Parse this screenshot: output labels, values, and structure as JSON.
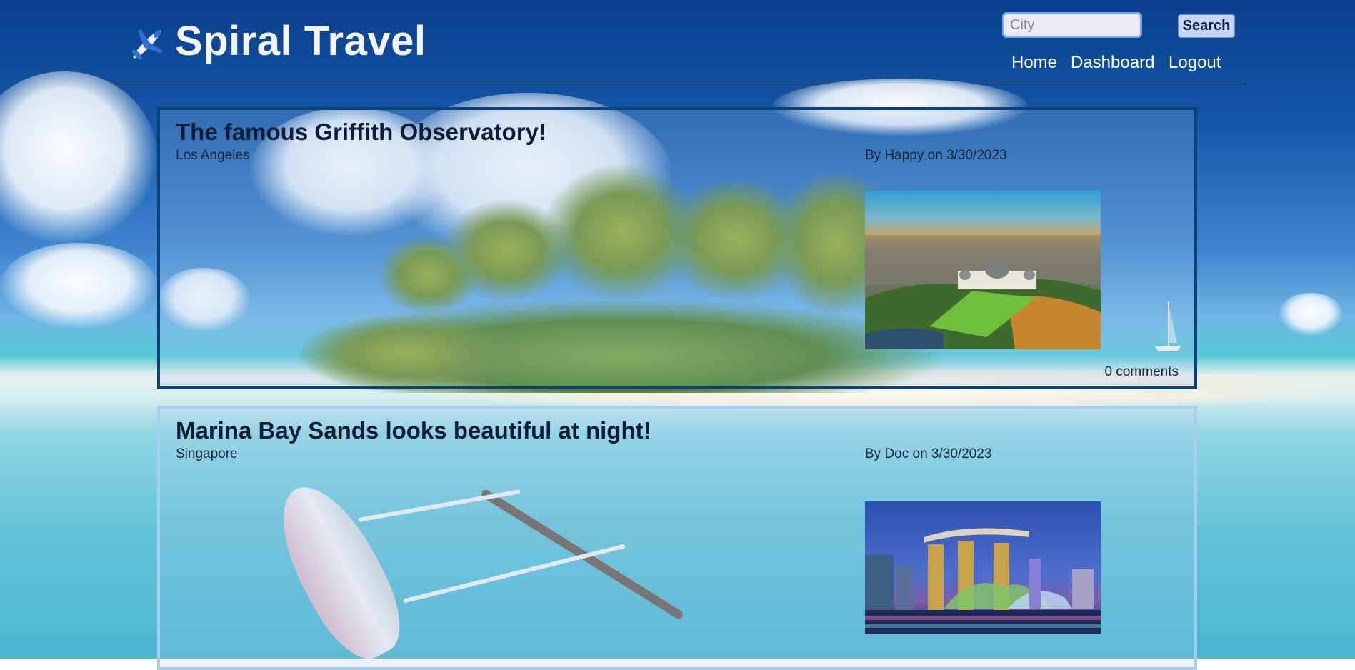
{
  "header": {
    "brand": "Spiral Travel",
    "logo_icon": "airplane-icon",
    "search": {
      "placeholder": "City",
      "value": "",
      "button_label": "Search"
    },
    "nav": {
      "home": "Home",
      "dashboard": "Dashboard",
      "logout": "Logout"
    }
  },
  "posts": [
    {
      "title": "The famous Griffith Observatory!",
      "city": "Los Angeles",
      "byline": "By Happy on 3/30/2023",
      "comments": "0 comments",
      "photo": "griffith-observatory-photo"
    },
    {
      "title": "Marina Bay Sands looks beautiful at night!",
      "city": "Singapore",
      "byline": "By Doc on 3/30/2023",
      "photo": "marina-bay-sands-photo"
    }
  ],
  "colors": {
    "brand_text": "#f3f4fa",
    "post1_border": "#0c4178",
    "post2_border": "#a9cdf0",
    "search_button": "#c3d6f7",
    "search_border": "#7aa7ea"
  }
}
